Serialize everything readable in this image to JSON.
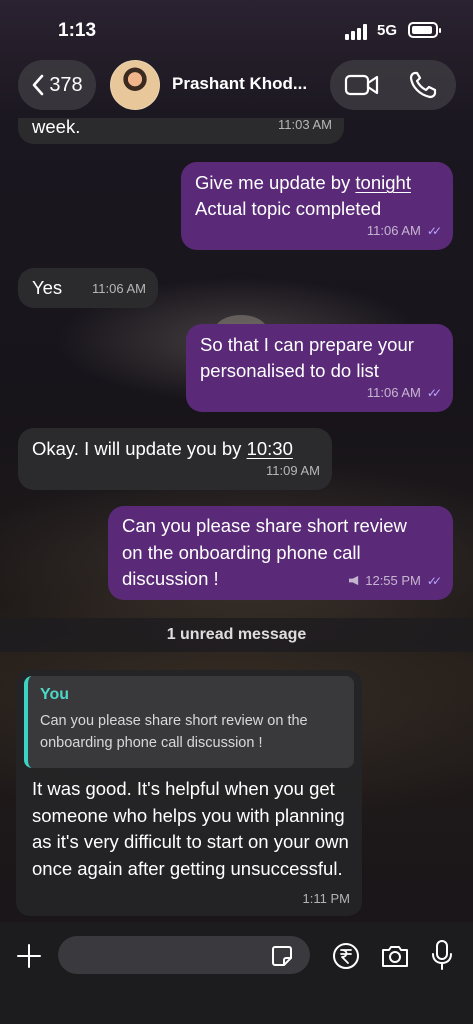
{
  "status_bar": {
    "time": "1:13",
    "network": "5G"
  },
  "header": {
    "back_count": "378",
    "contact_name": "Prashant Khod..."
  },
  "messages": [
    {
      "direction": "in",
      "text": "week.",
      "time": "11:03 AM"
    },
    {
      "direction": "out",
      "line1_pre": "Give me update by ",
      "line1_link": "tonight",
      "line2": "Actual topic completed",
      "time": "11:06 AM",
      "ticks": "✓✓"
    },
    {
      "direction": "in",
      "text": "Yes",
      "time": "11:06 AM"
    },
    {
      "direction": "out",
      "line1": "So that I can prepare your",
      "line2": "personalised to do list",
      "time": "11:06 AM",
      "ticks": "✓✓"
    },
    {
      "direction": "in",
      "text_pre": "Okay. I will update you by ",
      "text_link": "10:30",
      "time": "11:09 AM"
    },
    {
      "direction": "out",
      "line1": "Can you please share short review",
      "line2": "on the onboarding phone call",
      "line3": "discussion !",
      "time": "12:55 PM",
      "ticks": "✓✓"
    }
  ],
  "unread_label": "1 unread message",
  "reply": {
    "quote_author": "You",
    "quote_text": "Can you please share short review on the onboarding phone call discussion !",
    "text": "It was good. It's helpful when you get someone who helps you with planning as it's very difficult to start on your own once again after getting unsuccessful.",
    "time": "1:11 PM"
  },
  "composer": {
    "placeholder": ""
  },
  "colors": {
    "outgoing_bubble": "#5a2a78",
    "incoming_bubble": "#2c2c2e",
    "quote_accent": "#3cd3c3",
    "read_ticks": "#b9a3ff"
  }
}
